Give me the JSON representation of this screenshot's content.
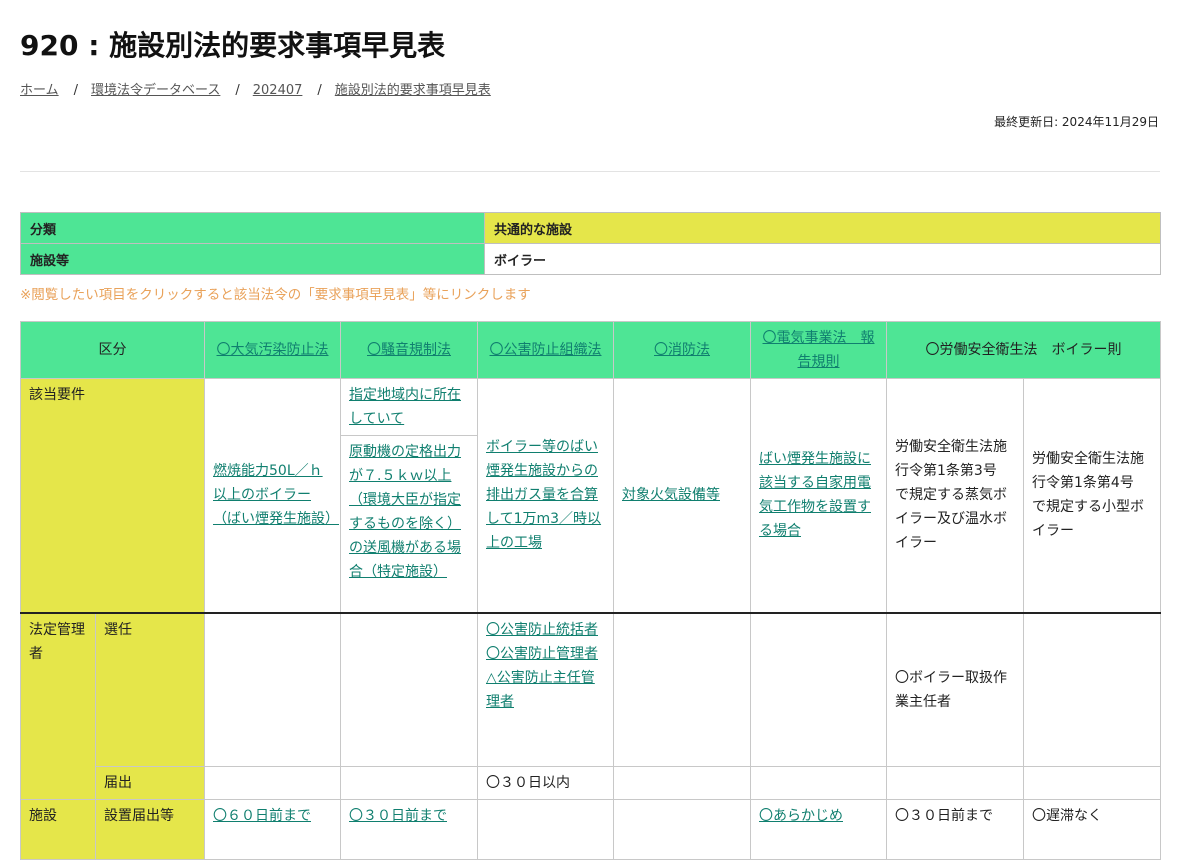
{
  "page": {
    "title": "920 : 施設別法的要求事項早見表",
    "updated": "最終更新日: 2024年11月29日"
  },
  "breadcrumb": [
    "ホーム",
    "環境法令データベース",
    "202407",
    "施設別法的要求事項早見表"
  ],
  "info": {
    "row1_label": "分類",
    "row1_value": "共通的な施設",
    "row2_label": "施設等",
    "row2_value": "ボイラー"
  },
  "note": "※閲覧したい項目をクリックすると該当法令の「要求事項早見表」等にリンクします",
  "table": {
    "headers": [
      "区分",
      "〇大気汚染防止法",
      "〇騒音規制法",
      "〇公害防止組織法",
      "〇消防法",
      "〇電気事業法　報告規則",
      "〇労働安全衛生法　ボイラー則"
    ],
    "applicable": {
      "label": "該当要件",
      "air": "燃焼能力50L／ｈ以上のボイラー（ばい煙発生施設）",
      "noise_1": "指定地域内に所在していて",
      "noise_2": "原動機の定格出力が７.５ｋｗ以上（環境大臣が指定するものを除く）の送風機がある場合（特定施設）",
      "pollution": "ボイラー等のばい煙発生施設からの排出ガス量を合算して1万m3／時以上の工場",
      "fire": "対象火気設備等",
      "electric": "ばい煙発生施設に該当する自家用電気工作物を設置する場合",
      "labor_1": "労働安全衛生法施行令第1条第3号 で規定する蒸気ボイラー及び温水ボイラー",
      "labor_2": "労働安全衛生法施行令第1条第4号 で規定する小型ボイラー"
    },
    "manager": {
      "label": "法定管理者",
      "appoint_label": "選任",
      "pollution_1": "〇公害防止統括者",
      "pollution_2": "〇公害防止管理者",
      "pollution_3": "△公害防止主任管理者",
      "labor_1": "〇ボイラー取扱作業主任者",
      "notify_label": "届出",
      "notify_pollution": "〇３０日以内"
    },
    "facility": {
      "label": "施設",
      "sublabel": "設置届出等",
      "air": "〇６０日前まで",
      "noise": "〇３０日前まで",
      "electric": "〇あらかじめ",
      "labor_1": "〇３０日前まで",
      "labor_2": "〇遅滞なく"
    }
  }
}
